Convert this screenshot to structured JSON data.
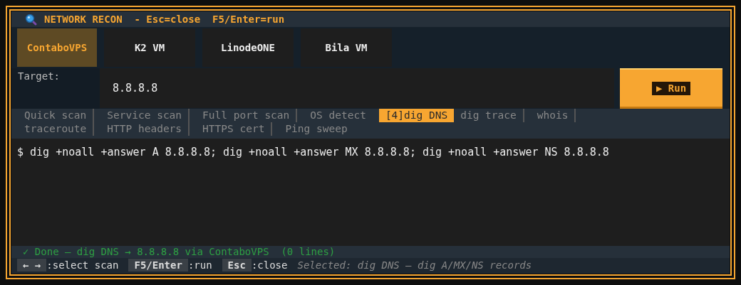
{
  "window": {
    "title": "NETWORK RECON  - Esc=close  F5/Enter=run"
  },
  "hosts": [
    {
      "label": "ContaboVPS",
      "selected": true
    },
    {
      "label": "K2 VM",
      "selected": false
    },
    {
      "label": "LinodeONE",
      "selected": false
    },
    {
      "label": "Bila VM",
      "selected": false
    }
  ],
  "target": {
    "label": "Target:",
    "value": "8.8.8.8"
  },
  "run_button": {
    "label": "▶ Run"
  },
  "scans": [
    {
      "label": "Quick scan",
      "selected": false
    },
    {
      "label": "Service scan",
      "selected": false
    },
    {
      "label": "Full port scan",
      "selected": false
    },
    {
      "label": "OS detect",
      "selected": false
    },
    {
      "label": "[4]dig DNS",
      "selected": true
    },
    {
      "label": "dig trace",
      "selected": false
    },
    {
      "label": "whois",
      "selected": false
    },
    {
      "label": "traceroute",
      "selected": false
    },
    {
      "label": "HTTP headers",
      "selected": false
    },
    {
      "label": "HTTPS cert",
      "selected": false
    },
    {
      "label": "Ping sweep",
      "selected": false
    }
  ],
  "output": {
    "command": "$ dig +noall +answer A 8.8.8.8; dig +noall +answer MX 8.8.8.8; dig +noall +answer NS 8.8.8.8"
  },
  "status": {
    "kind": "success",
    "text": "✓ Done – dig DNS → 8.8.8.8 via ContaboVPS  (0 lines)"
  },
  "key_hints": [
    {
      "key": "← →",
      "action": ":select scan"
    },
    {
      "key": "F5/Enter",
      "action": ":run"
    },
    {
      "key": "Esc",
      "action": ":close"
    }
  ],
  "selection_note": "Selected: dig DNS – dig A/MX/NS records"
}
